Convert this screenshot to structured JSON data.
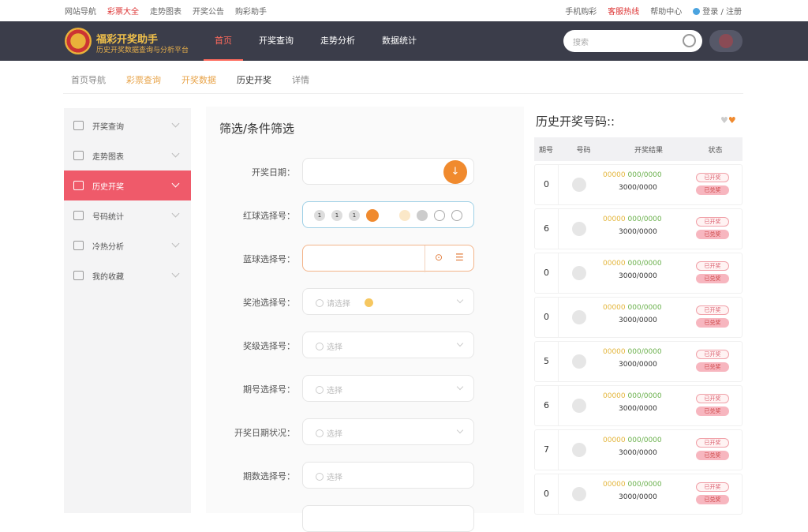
{
  "topbar": {
    "left": [
      "网站导航",
      "彩票大全",
      "走势图表",
      "开奖公告",
      "购彩助手"
    ],
    "right": [
      "手机购彩",
      "客服热线",
      "帮助中心",
      "登录 / 注册"
    ]
  },
  "header": {
    "brand_line1": "福彩开奖助手",
    "brand_line2": "历史开奖数据查询与分析平台",
    "nav": [
      "首页",
      "开奖查询",
      "走势分析",
      "数据统计"
    ],
    "search_placeholder": "搜索"
  },
  "breadcrumbs": [
    "首页导航",
    "彩票查询",
    "开奖数据",
    "历史开奖",
    "详情"
  ],
  "sidebar": {
    "items": [
      {
        "label": "开奖查询",
        "icon": "checkbox-icon"
      },
      {
        "label": "走势图表",
        "icon": "list-icon"
      },
      {
        "label": "历史开奖",
        "icon": "calendar-icon"
      },
      {
        "label": "号码统计",
        "icon": "info-icon"
      },
      {
        "label": "冷热分析",
        "icon": "document-icon"
      },
      {
        "label": "我的收藏",
        "icon": "folder-icon"
      }
    ]
  },
  "form": {
    "title": "筛选/条件筛选",
    "fields": [
      {
        "label": "开奖日期：",
        "placeholder": ""
      },
      {
        "label": "红球选择号：",
        "placeholder": ""
      },
      {
        "label": "蓝球选择号：",
        "placeholder": ""
      },
      {
        "label": "奖池选择号：",
        "placeholder": "请选择"
      },
      {
        "label": "奖级选择号：",
        "placeholder": "选择"
      },
      {
        "label": "期号选择号：",
        "placeholder": "选择"
      },
      {
        "label": "开奖日期状况：",
        "placeholder": "选择"
      },
      {
        "label": "期数选择号：",
        "placeholder": "选择"
      }
    ],
    "ball_numbers": [
      "1",
      "1",
      "1"
    ],
    "time_symbol": "⊙",
    "filter_symbol": "☰"
  },
  "history": {
    "title": "历史开奖号码::",
    "columns": [
      "期号",
      "号码",
      "开奖结果",
      "状态"
    ],
    "rows": [
      {
        "n": "0",
        "top_y": "00000",
        "top_g": "000/0000",
        "bottom": "3000/0000",
        "tag1": "已开奖",
        "tag2": "已兑奖"
      },
      {
        "n": "6",
        "top_y": "00000",
        "top_g": "000/0000",
        "bottom": "3000/0000",
        "tag1": "已开奖",
        "tag2": "已兑奖"
      },
      {
        "n": "0",
        "top_y": "00000",
        "top_g": "000/0000",
        "bottom": "3000/0000",
        "tag1": "已开奖",
        "tag2": "已兑奖"
      },
      {
        "n": "0",
        "top_y": "00000",
        "top_g": "000/0000",
        "bottom": "3000/0000",
        "tag1": "已开奖",
        "tag2": "已兑奖"
      },
      {
        "n": "5",
        "top_y": "00000",
        "top_g": "000/0000",
        "bottom": "3000/0000",
        "tag1": "已开奖",
        "tag2": "已兑奖"
      },
      {
        "n": "6",
        "top_y": "00000",
        "top_g": "000/0000",
        "bottom": "3000/0000",
        "tag1": "已开奖",
        "tag2": "已兑奖"
      },
      {
        "n": "7",
        "top_y": "00000",
        "top_g": "000/0000",
        "bottom": "3000/0000",
        "tag1": "已开奖",
        "tag2": "已兑奖"
      },
      {
        "n": "0",
        "top_y": "00000",
        "top_g": "000/0000",
        "bottom": "3000/0000",
        "tag1": "已开奖",
        "tag2": "已兑奖"
      }
    ]
  },
  "colors": {
    "header": "#3b3d4a",
    "accent": "#ef5a6a",
    "orange": "#f08a2e"
  }
}
